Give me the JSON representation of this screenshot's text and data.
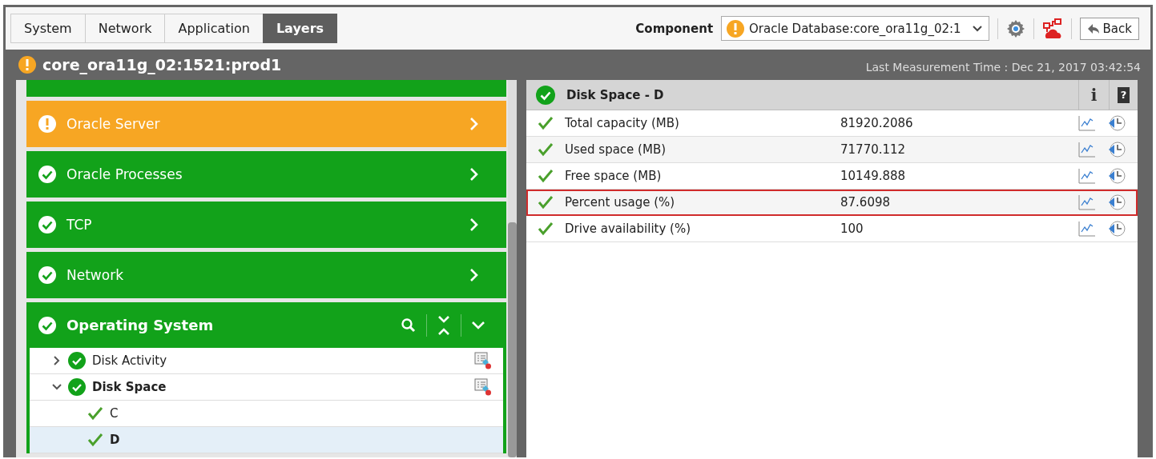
{
  "tabs": [
    {
      "label": "System",
      "selected": false
    },
    {
      "label": "Network",
      "selected": false
    },
    {
      "label": "Application",
      "selected": false
    },
    {
      "label": "Layers",
      "selected": true
    }
  ],
  "component": {
    "label": "Component",
    "warning": true,
    "value": "Oracle Database:core_ora11g_02:1"
  },
  "toolbar": {
    "back": "Back"
  },
  "header": {
    "warning": true,
    "title": "core_ora11g_02:1521:prod1",
    "last_measurement": "Last Measurement Time : Dec 21, 2017 03:42:54"
  },
  "layers": [
    {
      "warning": false
    },
    {
      "name": "Oracle Server",
      "warning": true,
      "expanded": false
    },
    {
      "name": "Oracle Processes",
      "warning": false,
      "expanded": false
    },
    {
      "name": "TCP",
      "warning": false,
      "expanded": false
    },
    {
      "name": "Network",
      "warning": false,
      "expanded": false
    },
    {
      "name": "Operating System",
      "warning": false,
      "expanded": true,
      "tests": [
        {
          "label": "Disk Activity",
          "warning": false,
          "expanded": false
        },
        {
          "label": "Disk Space",
          "warning": false,
          "expanded": true,
          "children": [
            {
              "label": "C",
              "selected": false
            },
            {
              "label": "D",
              "selected": true
            }
          ]
        }
      ]
    }
  ],
  "detail": {
    "warning": false,
    "title": "Disk Space - D",
    "info": "i",
    "help": "?",
    "rows": [
      {
        "name": "Total capacity (MB)",
        "value": "81920.2086",
        "outlined": false
      },
      {
        "name": "Used space (MB)",
        "value": "71770.112",
        "outlined": false
      },
      {
        "name": "Free space (MB)",
        "value": "10149.888",
        "outlined": false
      },
      {
        "name": "Percent usage (%)",
        "value": "87.6098",
        "outlined": true
      },
      {
        "name": "Drive availability (%)",
        "value": "100",
        "outlined": false
      }
    ]
  }
}
